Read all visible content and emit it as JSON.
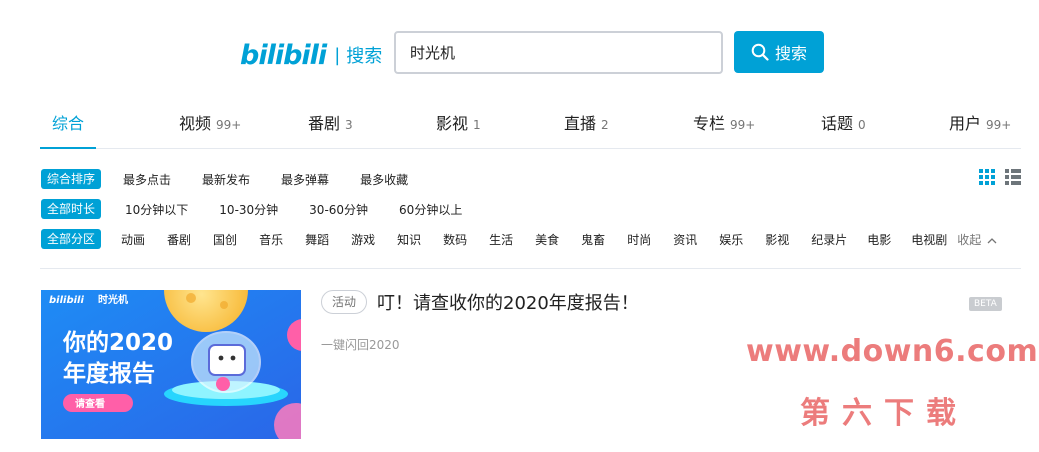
{
  "header": {
    "logo_mark": "bilibili",
    "logo_sep": "|",
    "logo_text": "搜索",
    "search_value": "时光机",
    "search_button_label": "搜索"
  },
  "tabs": [
    {
      "label": "综合",
      "count": "",
      "active": true
    },
    {
      "label": "视频",
      "count": "99+"
    },
    {
      "label": "番剧",
      "count": "3"
    },
    {
      "label": "影视",
      "count": "1"
    },
    {
      "label": "直播",
      "count": "2"
    },
    {
      "label": "专栏",
      "count": "99+"
    },
    {
      "label": "话题",
      "count": "0"
    },
    {
      "label": "用户",
      "count": "99+"
    }
  ],
  "filters": {
    "sort": {
      "tag": "综合排序",
      "items": [
        "最多点击",
        "最新发布",
        "最多弹幕",
        "最多收藏"
      ]
    },
    "duration": {
      "tag": "全部时长",
      "items": [
        "10分钟以下",
        "10-30分钟",
        "30-60分钟",
        "60分钟以上"
      ]
    },
    "zone": {
      "tag": "全部分区",
      "items": [
        "动画",
        "番剧",
        "国创",
        "音乐",
        "舞蹈",
        "游戏",
        "知识",
        "数码",
        "生活",
        "美食",
        "鬼畜",
        "时尚",
        "资讯",
        "娱乐",
        "影视",
        "纪录片",
        "电影",
        "电视剧"
      ],
      "collapse_label": "收起"
    }
  },
  "result": {
    "banner": {
      "brand": "bilibili",
      "brand_sub": "时光机",
      "line1": "你的2020",
      "line2": "年度报告",
      "cta": "请查看"
    },
    "badge": "活动",
    "title": "叮！请查收你的2020年度报告！",
    "beta": "BETA",
    "subtitle": "一键闪回2020"
  },
  "watermark": {
    "line1": "www.down6.com",
    "line2": "第六下载"
  },
  "colors": {
    "accent": "#00a1d6",
    "watermark": "#ec7c7c"
  }
}
